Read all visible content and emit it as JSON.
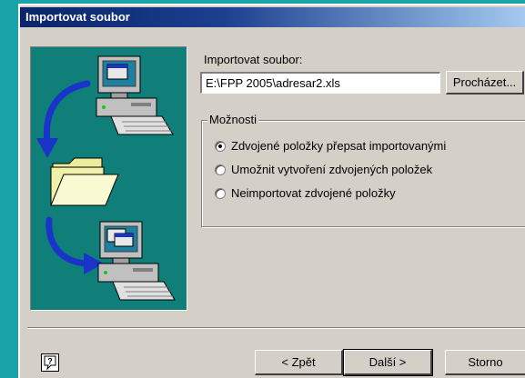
{
  "window": {
    "title": "Importovat soubor"
  },
  "file_label": "Importovat soubor:",
  "file_path": "E:\\FPP 2005\\adresar2.xls",
  "browse_label": "Procházet...",
  "options": {
    "group_label": "Možnosti",
    "radios": [
      {
        "label": "Zdvojené položky přepsat importovanými",
        "checked": true
      },
      {
        "label": "Umožnit vytvoření zdvojených položek",
        "checked": false
      },
      {
        "label": "Neimportovat zdvojené položky",
        "checked": false
      }
    ]
  },
  "buttons": {
    "back": "< Zpět",
    "next": "Další >",
    "cancel": "Storno"
  },
  "colors": {
    "desktop": "#19a3a8",
    "dialog": "#d4d0c8",
    "title_bar": "#0a246a",
    "illustration_bg": "#107f7a",
    "arrow": "#1a33c8"
  },
  "icons": {
    "help": "help-icon",
    "top_computer": "computer-icon",
    "folder": "folder-icon",
    "bottom_computer": "computer-icon",
    "arrows": "arrow-icon"
  }
}
